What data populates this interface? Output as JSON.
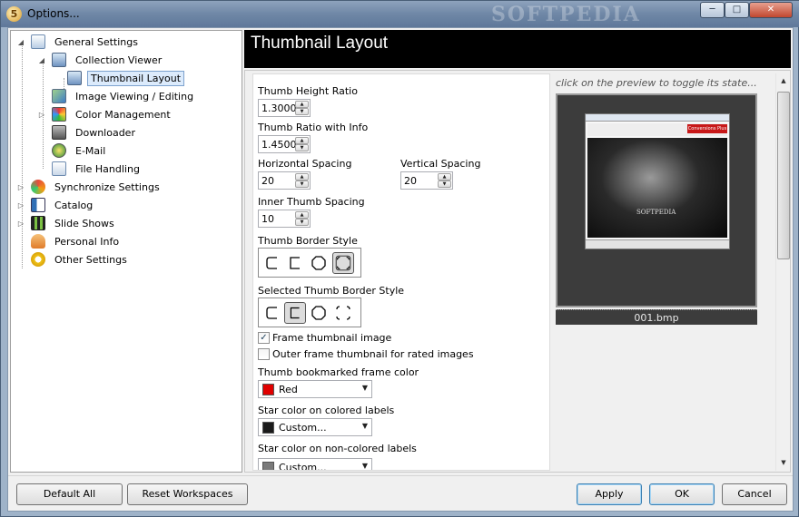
{
  "window": {
    "title": "Options..."
  },
  "watermark": "SOFTPEDIA",
  "tree": {
    "items": [
      {
        "label": "General Settings"
      },
      {
        "label": "Collection Viewer"
      },
      {
        "label": "Thumbnail Layout"
      },
      {
        "label": "Image Viewing / Editing"
      },
      {
        "label": "Color Management"
      },
      {
        "label": "Downloader"
      },
      {
        "label": "E-Mail"
      },
      {
        "label": "File Handling"
      },
      {
        "label": "Synchronize Settings"
      },
      {
        "label": "Catalog"
      },
      {
        "label": "Slide Shows"
      },
      {
        "label": "Personal Info"
      },
      {
        "label": "Other Settings"
      }
    ]
  },
  "header": {
    "title": "Thumbnail Layout"
  },
  "settings": {
    "thumb_height_ratio": {
      "label": "Thumb Height Ratio",
      "value": "1.3000"
    },
    "thumb_ratio_info": {
      "label": "Thumb Ratio with Info",
      "value": "1.4500"
    },
    "horizontal_spacing": {
      "label": "Horizontal Spacing",
      "value": "20"
    },
    "vertical_spacing": {
      "label": "Vertical Spacing",
      "value": "20"
    },
    "inner_spacing": {
      "label": "Inner Thumb Spacing",
      "value": "10"
    },
    "border_style": {
      "label": "Thumb Border Style"
    },
    "selected_border_style": {
      "label": "Selected Thumb Border Style"
    },
    "frame_thumbnail": {
      "label": "Frame thumbnail image",
      "checked": true
    },
    "outer_frame": {
      "label": "Outer frame thumbnail for rated images",
      "checked": false
    },
    "bookmarked_color": {
      "label": "Thumb bookmarked frame color",
      "value": "Red",
      "swatch": "#e00000"
    },
    "star_colored": {
      "label": "Star color on colored labels",
      "value": "Custom...",
      "swatch": "#1a1a1a"
    },
    "star_noncolored": {
      "label": "Star color on non-colored labels",
      "value": "Custom...",
      "swatch": "#7a7a7a"
    }
  },
  "preview": {
    "hint": "click on the preview to toggle its state...",
    "caption": "001.bmp",
    "image_text": "SOFTPEDIA",
    "banner": "Conversions Plus"
  },
  "buttons": {
    "default_all": "Default All",
    "reset_workspaces": "Reset Workspaces",
    "apply": "Apply",
    "ok": "OK",
    "cancel": "Cancel"
  }
}
